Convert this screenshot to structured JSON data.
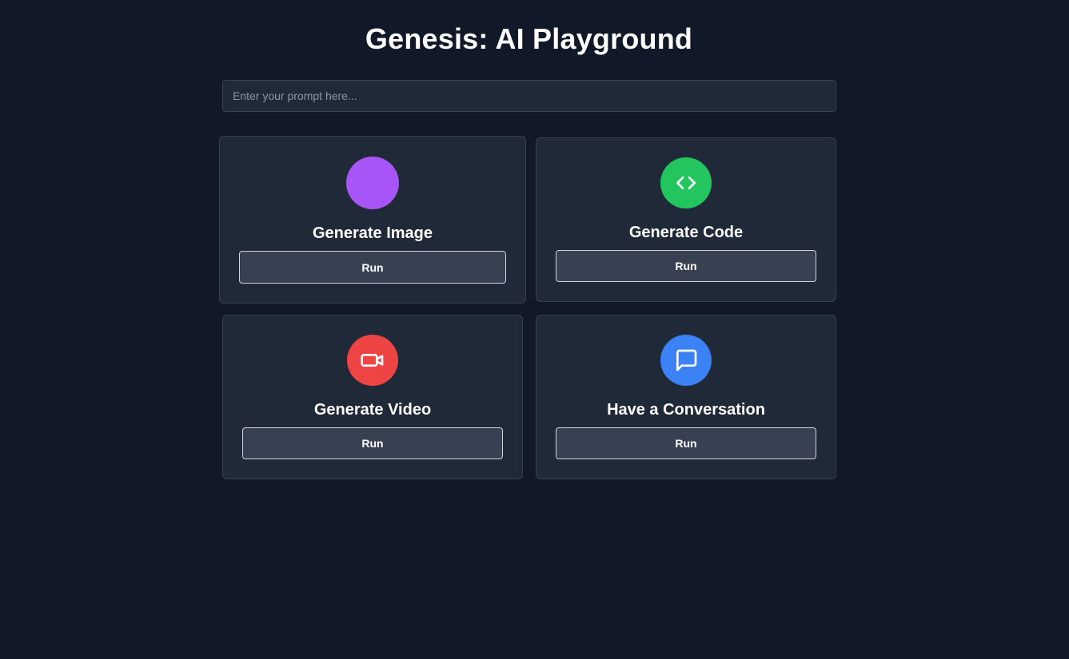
{
  "header": {
    "title": "Genesis: AI Playground"
  },
  "prompt": {
    "placeholder": "Enter your prompt here...",
    "value": ""
  },
  "cards": [
    {
      "title": "Generate Image",
      "button_label": "Run",
      "icon": "image-icon",
      "color": "#a855f7"
    },
    {
      "title": "Generate Code",
      "button_label": "Run",
      "icon": "code-icon",
      "color": "#22c55e"
    },
    {
      "title": "Generate Video",
      "button_label": "Run",
      "icon": "video-camera-icon",
      "color": "#ef4444"
    },
    {
      "title": "Have a Conversation",
      "button_label": "Run",
      "icon": "chat-bubble-icon",
      "color": "#3b82f6"
    }
  ],
  "theme": {
    "background": "#111827",
    "card_background": "#1f2937",
    "button_background": "#374151"
  }
}
